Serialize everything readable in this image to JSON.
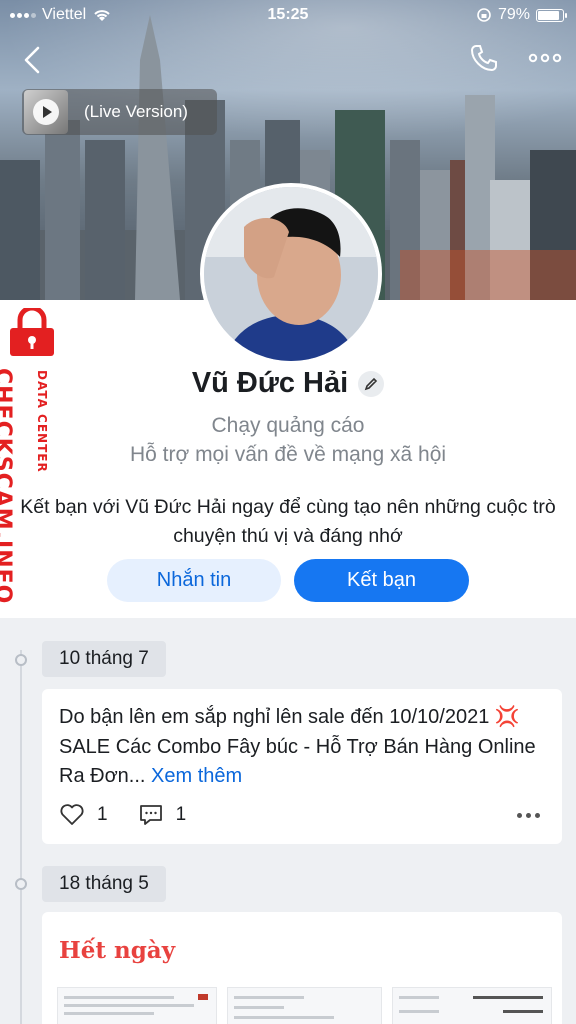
{
  "status_bar": {
    "carrier": "Viettel",
    "time": "15:25",
    "battery": "79%",
    "battery_level": 0.79
  },
  "cover": {
    "music_label": "(Live Version)"
  },
  "profile": {
    "name": "Vũ Đức Hải",
    "bio_line1": "Chạy quảng cáo",
    "bio_line2": "Hỗ trợ mọi vấn đề về mạng xã hội",
    "invite_text": "Kết bạn với Vũ Đức Hải ngay để cùng tạo nên những cuộc trò chuyện thú vị và đáng nhớ",
    "message_button": "Nhắn tin",
    "add_friend_button": "Kết bạn"
  },
  "watermark": {
    "brand": "CHECKSCAM.INFO",
    "sub": "DATA CENTER"
  },
  "timeline": [
    {
      "date": "10 tháng 7",
      "text": "Do bận lên em sắp nghỉ lên sale đến 10/10/2021 💢 SALE Các Combo Fây búc - Hỗ Trợ Bán Hàng Online Ra Đơn...",
      "see_more": "Xem thêm",
      "likes": "1",
      "comments": "1"
    },
    {
      "date": "18 tháng 5",
      "headline": "Hết ngày"
    }
  ],
  "colors": {
    "accent": "#1677f2",
    "watermark": "#e32021",
    "headline": "#e8423f"
  },
  "icons": [
    "back-icon",
    "phone-icon",
    "more-icon",
    "wifi-icon",
    "edit-icon",
    "heart-icon",
    "comment-icon",
    "play-icon",
    "lock-icon"
  ]
}
